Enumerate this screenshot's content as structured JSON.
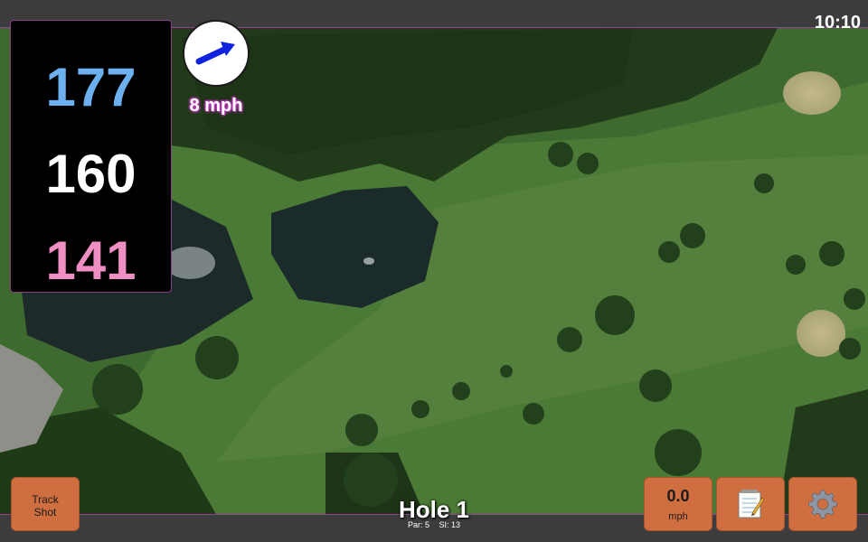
{
  "status": {
    "time": "10:10"
  },
  "distances": {
    "back": "177",
    "center": "160",
    "front": "141"
  },
  "wind": {
    "speed": "8 mph",
    "direction_icon": "wind-arrow-icon"
  },
  "hole": {
    "title": "Hole 1",
    "par": "Par: 5",
    "stroke_index": "SI: 13"
  },
  "buttons": {
    "track_shot_line1": "Track",
    "track_shot_line2": "Shot",
    "speed_value": "0.0",
    "speed_unit": "mph",
    "notes_icon": "notepad-icon",
    "settings_icon": "gear-icon"
  },
  "colors": {
    "back": "#6db0ef",
    "center": "#ffffff",
    "front": "#ef8ec2",
    "button": "#cf6f3f",
    "wind_text_glow": "#c03ec0",
    "border_accent": "#9c3f9c"
  }
}
